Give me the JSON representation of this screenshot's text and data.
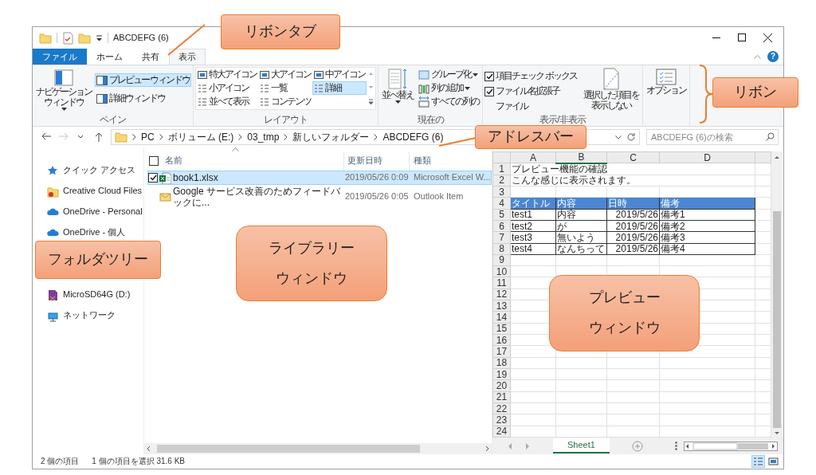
{
  "title_bar": {
    "title": "ABCDEFG (6)"
  },
  "ribbon_tabs": [
    {
      "label": "ファイル",
      "kind": "file",
      "selected": false
    },
    {
      "label": "ホーム",
      "kind": "tab",
      "selected": false
    },
    {
      "label": "共有",
      "kind": "tab",
      "selected": false
    },
    {
      "label": "表示",
      "kind": "tab",
      "selected": true
    }
  ],
  "help": "?",
  "ribbon": {
    "pane": {
      "label": "ペイン",
      "navigation": {
        "lines": [
          "ナビゲーション",
          "ウィンドウ"
        ],
        "dropdown": true
      },
      "buttons": [
        {
          "label": "プレビュー ウィンドウ",
          "selected": true
        },
        {
          "label": "詳細ウィンドウ",
          "selected": false
        }
      ]
    },
    "layout": {
      "label": "レイアウト",
      "items": [
        {
          "label": "特大アイコン",
          "selected": false
        },
        {
          "label": "大アイコン",
          "selected": false
        },
        {
          "label": "中アイコン",
          "selected": false
        },
        {
          "label": "小アイコン",
          "selected": false
        },
        {
          "label": "一覧",
          "selected": false
        },
        {
          "label": "詳細",
          "selected": true
        },
        {
          "label": "並べて表示",
          "selected": false
        },
        {
          "label": "コンテンツ",
          "selected": false
        }
      ]
    },
    "current_view": {
      "label": "現在の",
      "sort": {
        "label": "並べ替え",
        "dropdown": true
      },
      "items": [
        {
          "label": "グループ化",
          "dropdown": true
        },
        {
          "label": "列の追加",
          "dropdown": true
        },
        {
          "label": "すべての列の",
          "dropdown": false
        }
      ]
    },
    "show_hide": {
      "label": "表示/非表示",
      "checks": [
        {
          "label": "項目チェック ボックス",
          "checked": true
        },
        {
          "label": "ファイル名拡張子",
          "checked": true
        },
        {
          "label": "ファイル"
        }
      ],
      "hide_selected": {
        "lines": [
          "選択した項目を",
          "表示しない"
        ]
      }
    },
    "options": {
      "label": "オプション"
    }
  },
  "address_bar": {
    "nav_buttons": [
      {
        "kind": "back",
        "disabled": false
      },
      {
        "kind": "forward",
        "disabled": true
      },
      {
        "kind": "recent",
        "disabled": false
      },
      {
        "kind": "up",
        "disabled": false
      }
    ],
    "crumbs": [
      "PC",
      "ボリューム (E:)",
      "03_tmp",
      "新しいフォルダー",
      "ABCDEFG (6)"
    ],
    "search": {
      "placeholder": "ABCDEFG (6)の検索"
    }
  },
  "sidebar": {
    "items": [
      {
        "label": "クイック アクセス",
        "kind": "quick"
      },
      {
        "label": "Creative Cloud Files",
        "kind": "creative"
      },
      {
        "label": "OneDrive - Personal",
        "kind": "onedrive"
      },
      {
        "label": "OneDrive - 個人",
        "kind": "onedrive"
      },
      {
        "label": "MicroSD64G (D:)",
        "kind": "sdcard"
      },
      {
        "label": "ネットワーク",
        "kind": "network"
      }
    ]
  },
  "files": {
    "columns": [
      "名前",
      "更新日時",
      "種類"
    ],
    "select_all_checked": false,
    "rows": [
      {
        "name": "book1.xlsx",
        "date": "2019/05/26 0:09",
        "type": "Microsoft Excel W...",
        "kind": "excel",
        "selected": true,
        "checked": true
      },
      {
        "name": "Google サービス改善のためフィードバックに...",
        "date": "2019/05/26 0:05",
        "type": "Outlook Item",
        "kind": "mail",
        "selected": false,
        "checked": false
      }
    ]
  },
  "preview": {
    "columns": [
      {
        "label": "A",
        "selected": false
      },
      {
        "label": "B",
        "selected": true
      },
      {
        "label": "C",
        "selected": false
      },
      {
        "label": "D",
        "selected": false
      }
    ],
    "rows": [
      {
        "number": "1",
        "kind": "text",
        "cells": [
          "プレビュー機能の確認"
        ]
      },
      {
        "number": "2",
        "kind": "text",
        "cells": [
          "こんな感じに表示されます。"
        ]
      },
      {
        "number": "3",
        "kind": "empty"
      },
      {
        "number": "4",
        "kind": "header",
        "cells": [
          "タイトル",
          "内容",
          "日時",
          "備考"
        ]
      },
      {
        "number": "5",
        "kind": "data",
        "cells": [
          "test1",
          "内容",
          "2019/5/26",
          "備考1"
        ]
      },
      {
        "number": "6",
        "kind": "data",
        "cells": [
          "test2",
          "が",
          "2019/5/26",
          "備考2"
        ]
      },
      {
        "number": "7",
        "kind": "data",
        "cells": [
          "test3",
          "無いよう",
          "2019/5/26",
          "備考3"
        ]
      },
      {
        "number": "8",
        "kind": "data",
        "cells": [
          "test4",
          "なんちって",
          "2019/5/26",
          "備考4"
        ]
      },
      {
        "number": "9",
        "kind": "empty"
      },
      {
        "number": "10",
        "kind": "empty"
      },
      {
        "number": "11",
        "kind": "empty"
      },
      {
        "number": "12",
        "kind": "empty"
      },
      {
        "number": "13",
        "kind": "empty"
      },
      {
        "number": "14",
        "kind": "empty"
      },
      {
        "number": "15",
        "kind": "empty"
      },
      {
        "number": "16",
        "kind": "empty"
      },
      {
        "number": "17",
        "kind": "empty"
      },
      {
        "number": "18",
        "kind": "empty"
      },
      {
        "number": "19",
        "kind": "empty"
      },
      {
        "number": "20",
        "kind": "empty"
      },
      {
        "number": "21",
        "kind": "empty"
      },
      {
        "number": "22",
        "kind": "empty"
      },
      {
        "number": "23",
        "kind": "empty"
      },
      {
        "number": "24",
        "kind": "empty"
      }
    ],
    "sheet_tabs": [
      {
        "label": "Sheet1",
        "selected": true
      }
    ]
  },
  "status_bar": {
    "items": "2 個の項目",
    "selection": "1 個の項目を選択  31.6 KB",
    "views": [
      {
        "kind": "details",
        "selected": true
      },
      {
        "kind": "large",
        "selected": false
      }
    ]
  },
  "callouts": [
    {
      "lines": [
        "リボンタブ"
      ]
    },
    {
      "lines": [
        "リボン"
      ]
    },
    {
      "lines": [
        "アドレスバー"
      ]
    },
    {
      "lines": [
        "フォルダツリー"
      ]
    },
    {
      "lines": [
        "ライブラリー",
        "ウィンドウ"
      ]
    },
    {
      "lines": [
        "プレビュー",
        "ウィンドウ"
      ]
    }
  ]
}
